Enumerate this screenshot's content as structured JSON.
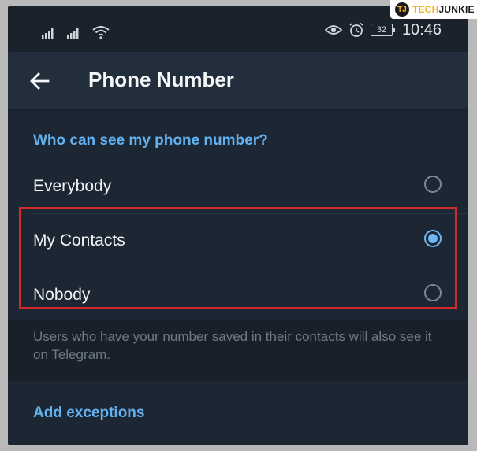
{
  "status_bar": {
    "time": "10:46",
    "battery": "32",
    "icons_left": [
      "signal-icon",
      "signal-icon",
      "wifi-icon"
    ],
    "icons_right": [
      "eye-icon",
      "alarm-icon",
      "battery-icon"
    ]
  },
  "watermark": {
    "logo": "TJ",
    "text_a": "TECH",
    "text_b": "JUNKIE"
  },
  "toolbar": {
    "title": "Phone Number"
  },
  "privacy": {
    "header": "Who can see my phone number?",
    "options": [
      {
        "label": "Everybody",
        "selected": false
      },
      {
        "label": "My Contacts",
        "selected": true
      },
      {
        "label": "Nobody",
        "selected": false
      }
    ],
    "info": "Users who have your number saved in their contacts will also see it on Telegram."
  },
  "exceptions": {
    "label": "Add exceptions"
  },
  "colors": {
    "accent": "#62b1f0",
    "background": "#1d2733",
    "highlight": "#d22b2b"
  }
}
